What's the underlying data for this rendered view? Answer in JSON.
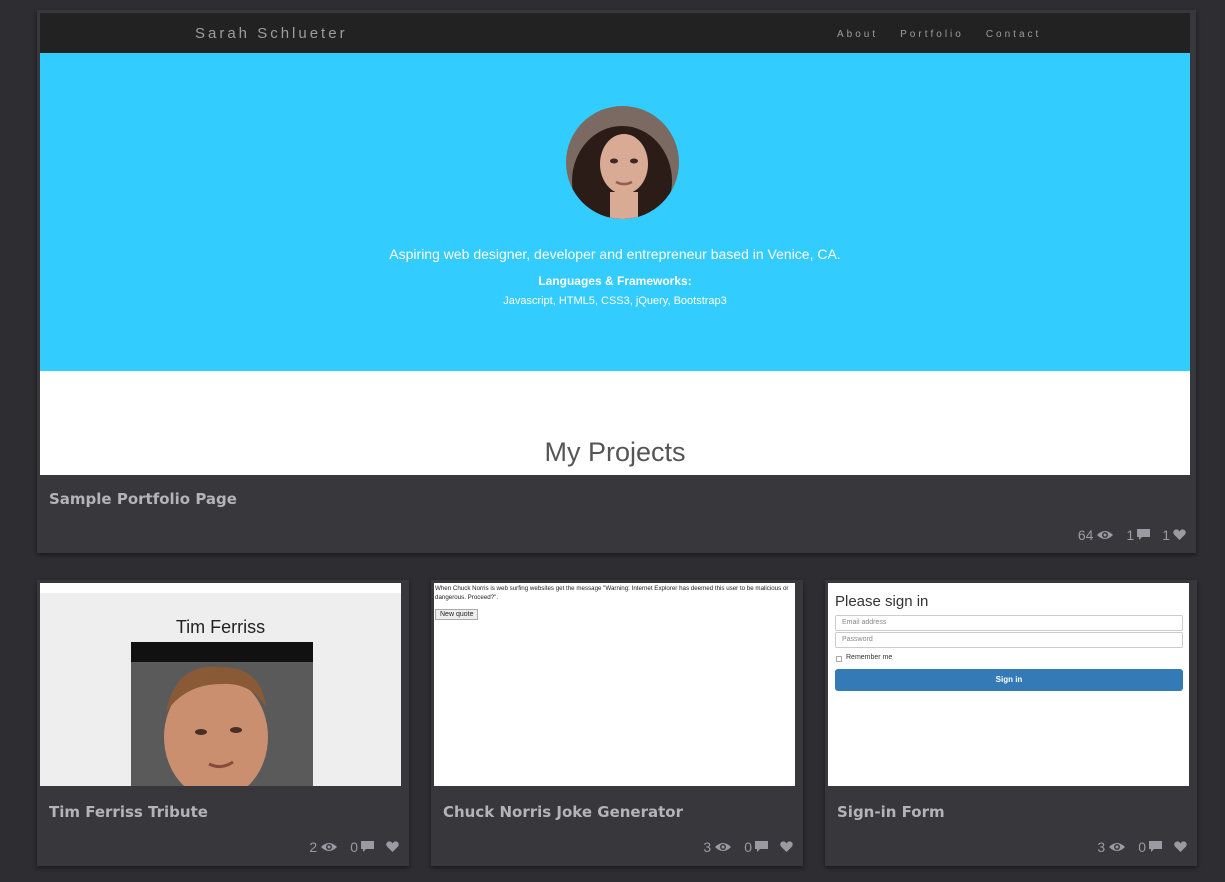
{
  "big_card": {
    "preview": {
      "brand": "Sarah Schlueter",
      "nav": [
        "About",
        "Portfolio",
        "Contact"
      ],
      "tagline": "Aspiring web designer, developer and entrepreneur based in Venice, CA.",
      "languages_heading": "Languages & Frameworks:",
      "languages": "Javascript, HTML5, CSS3, jQuery, Bootstrap3",
      "projects_heading": "My Projects"
    },
    "title": "Sample Portfolio Page",
    "views": "64",
    "comments": "1",
    "likes": "1"
  },
  "cards": [
    {
      "title": "Tim Ferriss Tribute",
      "views": "2",
      "comments": "0",
      "likes": "",
      "preview_heading": "Tim Ferriss"
    },
    {
      "title": "Chuck Norris Joke Generator",
      "views": "3",
      "comments": "0",
      "likes": "",
      "preview_quote": "When Chuck Norris is web surfing websites get the message \"Warning: Internet Explorer has deemed this user to be malicious or dangerous. Proceed?\".",
      "preview_button": "New quote"
    },
    {
      "title": "Sign-in Form",
      "views": "3",
      "comments": "0",
      "likes": "",
      "preview_heading": "Please sign in",
      "email_placeholder": "Email address",
      "password_placeholder": "Password",
      "remember": "Remember me",
      "signin_button": "Sign in"
    }
  ],
  "colors": {
    "page_bg": "#2e2d31",
    "card_bg": "#38373b",
    "hero_blue": "#33ccff",
    "navbar": "#222222",
    "signin_blue": "#337ab7"
  },
  "icons": [
    "eye-icon",
    "comment-icon",
    "heart-icon"
  ]
}
